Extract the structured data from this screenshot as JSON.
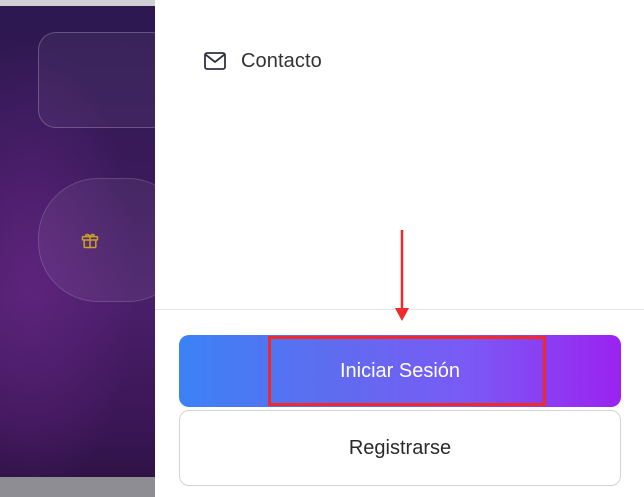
{
  "drawer": {
    "nav_items": [
      {
        "label": "Contacto",
        "icon": "mail-icon"
      }
    ],
    "login_button_label": "Iniciar Sesión",
    "register_button_label": "Registrarse"
  },
  "background": {
    "icons": [
      "gift-icon"
    ]
  },
  "annotation": {
    "target": "login-button",
    "color": "#ee2a2a"
  },
  "colors": {
    "gradient_start": "#3b82f6",
    "gradient_end": "#9b22f0",
    "gift_icon": "#c9a227",
    "background_dark": "#3a1a5a"
  }
}
